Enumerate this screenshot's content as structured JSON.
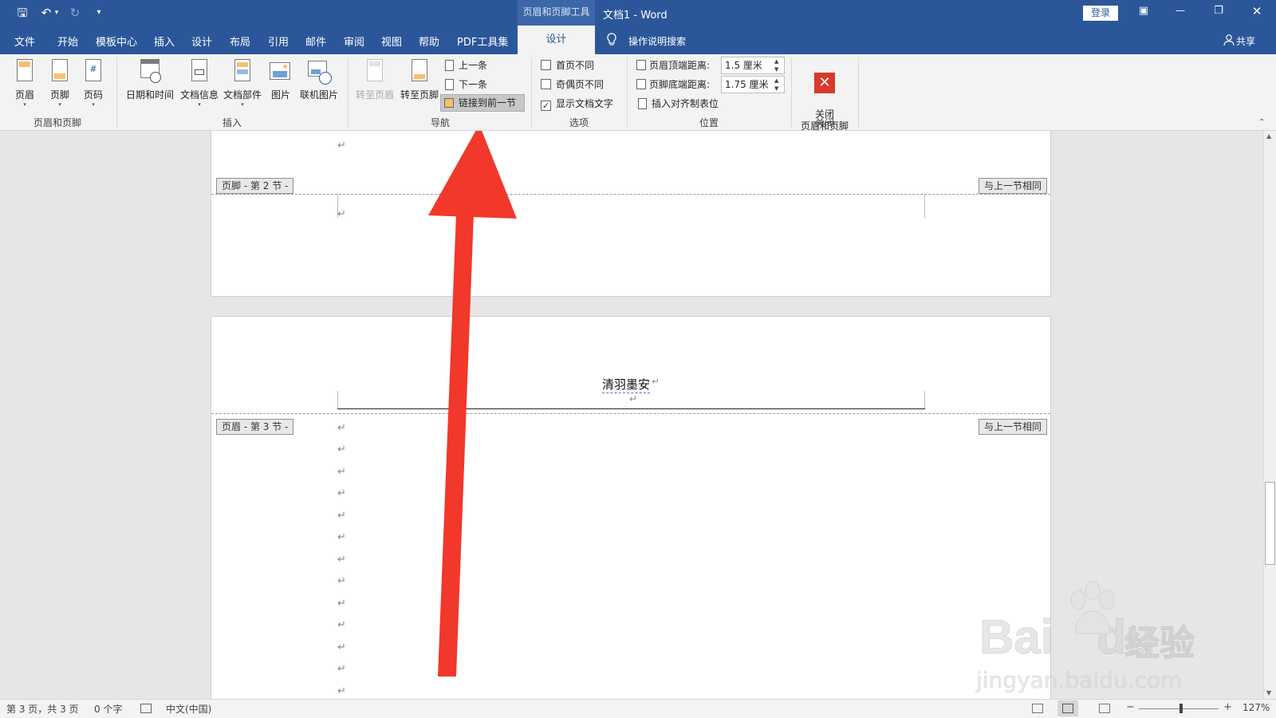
{
  "titlebar": {
    "context_tab": "页眉和页脚工具",
    "doc_title": "文档1  -  Word",
    "login_label": "登录",
    "qat_save_glyph": "🖫",
    "qat_undo_glyph": "↶",
    "qat_redo_glyph": "↻",
    "qat_more_glyph": "▾",
    "minimize_glyph": "—",
    "restore_glyph": "❐",
    "close_glyph": "✕",
    "ribbon_display_glyph": "▣"
  },
  "menu": {
    "items": [
      "文件",
      "开始",
      "模板中心",
      "插入",
      "设计",
      "布局",
      "引用",
      "邮件",
      "审阅",
      "视图",
      "帮助",
      "PDF工具集"
    ],
    "active_tab": "设计",
    "tell_me": "操作说明搜索",
    "share": "共享"
  },
  "ribbon": {
    "group_header_footer": {
      "label": "页眉和页脚",
      "header": "页眉",
      "footer": "页脚",
      "page_number": "页码"
    },
    "group_insert": {
      "label": "插入",
      "date_time": "日期和时间",
      "doc_info": "文档信息",
      "doc_parts": "文档部件",
      "picture": "图片",
      "online_picture": "联机图片"
    },
    "group_navigation": {
      "label": "导航",
      "goto_header": "转至页眉",
      "goto_footer": "转至页脚",
      "previous": "上一条",
      "next": "下一条",
      "link_previous": "链接到前一节"
    },
    "group_options": {
      "label": "选项",
      "diff_first": "首页不同",
      "diff_odd_even": "奇偶页不同",
      "show_doc_text": "显示文档文字",
      "diff_first_checked": false,
      "diff_odd_even_checked": false,
      "show_doc_text_checked": true
    },
    "group_position": {
      "label": "位置",
      "header_top_label": "页眉顶端距离:",
      "header_top_value": "1.5 厘米",
      "footer_bottom_label": "页脚底端距离:",
      "footer_bottom_value": "1.75 厘米",
      "insert_align_tab": "插入对齐制表位"
    },
    "group_close": {
      "label": "关闭",
      "close_label": "关闭\n页眉和页脚"
    }
  },
  "document": {
    "footer_tag": "页脚 - 第 2 节 -",
    "same_as_prev_1": "与上一节相同",
    "header_tag": "页眉 - 第 3 节 -",
    "same_as_prev_2": "与上一节相同",
    "header_text": "清羽墨安",
    "return_mark": "↵"
  },
  "statusbar": {
    "page_info": "第 3 页，共 3 页",
    "word_count": "0 个字",
    "language": "中文(中国)",
    "zoom": "127%",
    "zoom_percent": 127
  },
  "watermark": {
    "brand": "Bai",
    "brand2": "du",
    "cn": "经验",
    "url": "jingyan.baidu.com"
  },
  "colors": {
    "accent": "#2b579a",
    "arrow": "#f2372b",
    "close_red": "#d9392a"
  }
}
